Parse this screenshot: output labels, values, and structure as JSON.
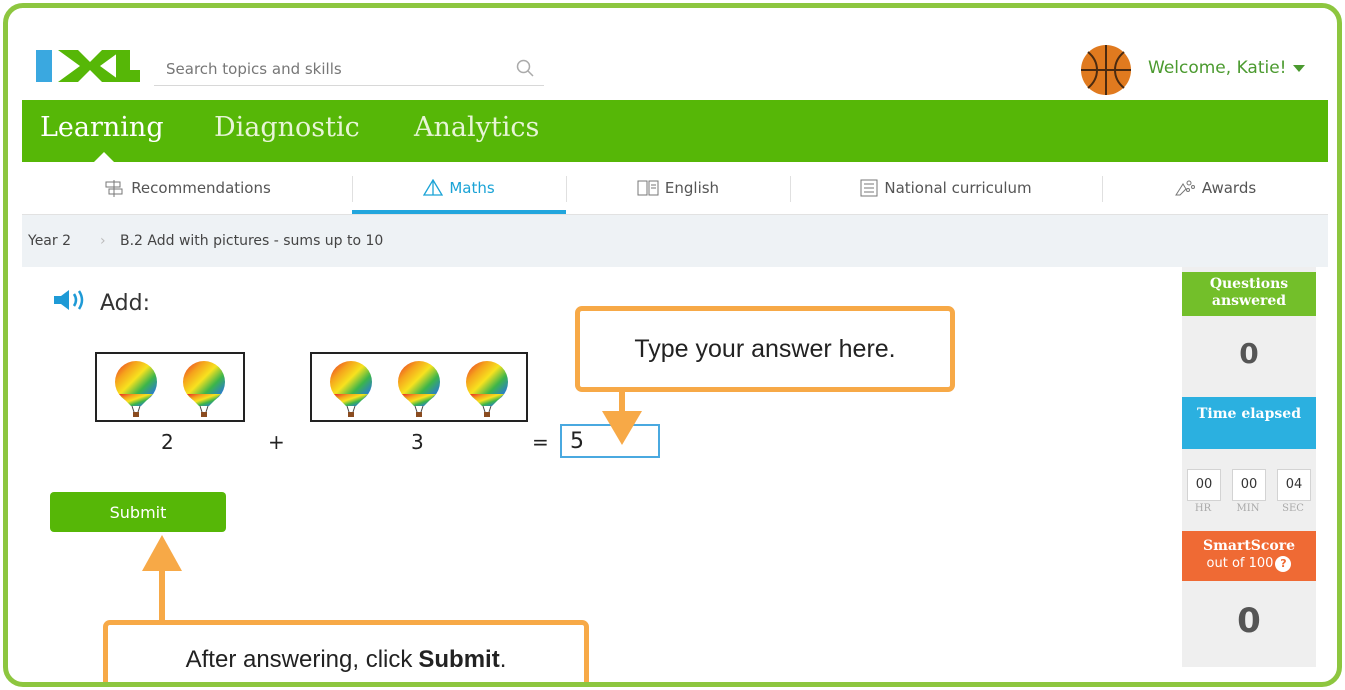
{
  "header": {
    "logo_text": "IXL",
    "search_placeholder": "Search topics and skills",
    "welcome": "Welcome, Katie!"
  },
  "main_nav": [
    "Learning",
    "Diagnostic",
    "Analytics"
  ],
  "sub_nav": [
    "Recommendations",
    "Maths",
    "English",
    "National curriculum",
    "Awards"
  ],
  "breadcrumb": {
    "level": "Year 2",
    "skill": "B.2 Add with pictures - sums up to 10"
  },
  "question": {
    "prompt": "Add:",
    "left_count": 2,
    "left_label": "2",
    "operator": "+",
    "right_count": 3,
    "right_label": "3",
    "equals": "=",
    "answer": "5"
  },
  "submit_label": "Submit",
  "callouts": {
    "answer_hint": "Type your answer here.",
    "submit_hint_prefix": "After answering, click",
    "submit_hint_bold": "Submit",
    "submit_hint_suffix": "."
  },
  "sidebar": {
    "questions_title": "Questions answered",
    "questions_value": "0",
    "time_title": "Time elapsed",
    "time_hr": "00",
    "time_min": "00",
    "time_sec": "04",
    "label_hr": "HR",
    "label_min": "MIN",
    "label_sec": "SEC",
    "smartscore_title": "SmartScore",
    "smartscore_sub": "out of 100",
    "smartscore_help": "?",
    "smartscore_value": "0"
  },
  "colors": {
    "brand_green": "#56b707",
    "accent_blue": "#22a6dd",
    "callout_orange": "#f7a947",
    "smartscore_orange": "#ef6a34"
  }
}
